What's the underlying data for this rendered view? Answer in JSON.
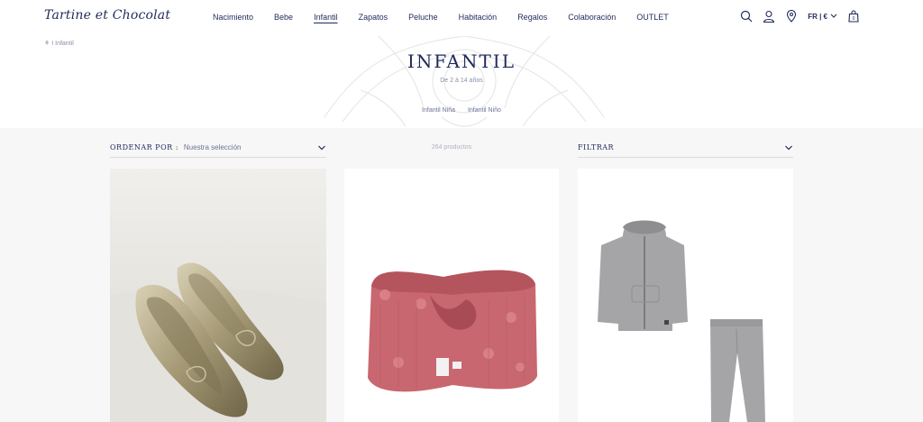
{
  "header": {
    "logo": "Tartine et Chocolat",
    "nav": [
      "Nacimiento",
      "Bebe",
      "Infantil",
      "Zapatos",
      "Peluche",
      "Habitación",
      "Regalos",
      "Colaboración",
      "OUTLET"
    ],
    "active_nav": "Infantil",
    "lang": "FR | €"
  },
  "hero": {
    "breadcrumb": "I Infantil",
    "title": "INFANTIL",
    "subtitle": "De 2 à 14 años",
    "sublinks": [
      "Infantil Niña",
      "Infantil Niño"
    ]
  },
  "toolbar": {
    "sort_label": "ORDENAR POR :",
    "sort_value": "Nuestra selección",
    "count": "264 productos",
    "filter_label": "FILTRAR"
  },
  "products": [
    {
      "image": "gold-ballet-flats"
    },
    {
      "image": "pink-knit-headband"
    },
    {
      "image": "grey-hoodie-and-pants"
    }
  ],
  "icons": [
    "search-icon",
    "user-icon",
    "location-icon",
    "bag-icon"
  ],
  "colors": {
    "brand": "#1f2a5a",
    "listing_bg": "#f7f7f7"
  }
}
